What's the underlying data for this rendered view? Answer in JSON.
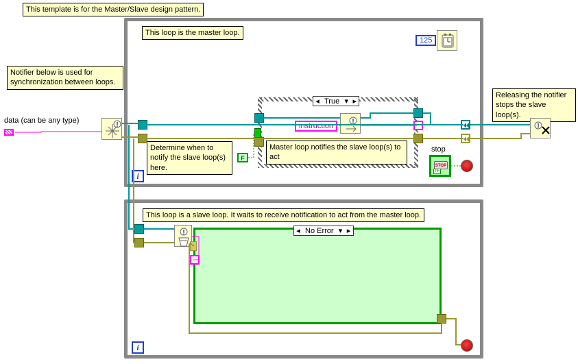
{
  "comments": {
    "template_desc": "This template is for the Master/Slave design pattern.",
    "master_loop": "This loop is the master loop.",
    "notifier_sync": "Notifier below is used for synchronization between loops.",
    "data_type": "data (can be any type)",
    "release_notifier": "Releasing the notifier stops the slave loop(s).",
    "determine_notify": "Determine when to notify the slave loop(s) here.",
    "master_notifies": "Master loop notifies the slave loop(s) to act",
    "slave_loop": "This loop is a slave loop. It waits to receive notification to act from the master loop."
  },
  "master": {
    "wait_ms": "125",
    "case_selector": "True",
    "instruction_label": "instruction",
    "false_const": "F",
    "stop_label": "stop",
    "i": "i"
  },
  "slave": {
    "case_selector": "No Error",
    "i": "i"
  }
}
